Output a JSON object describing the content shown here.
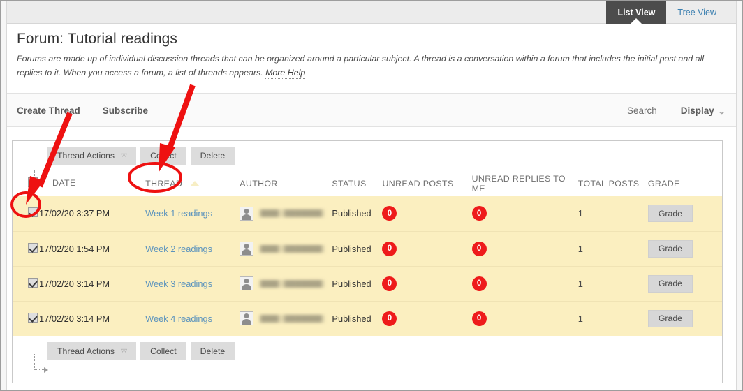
{
  "view_tabs": {
    "active": "List View",
    "inactive": "Tree View"
  },
  "header": {
    "title": "Forum: Tutorial readings",
    "description": "Forums are made up of individual discussion threads that can be organized around a particular subject. A thread is a conversation within a forum that includes the initial post and all replies to it. When you access a forum, a list of threads appears.",
    "more_help": "More Help"
  },
  "action_bar": {
    "create_thread": "Create Thread",
    "subscribe": "Subscribe",
    "search": "Search",
    "display": "Display",
    "display_caret": "⌄"
  },
  "bulk_toolbar": {
    "thread_actions": "Thread Actions",
    "thread_actions_caret": "»",
    "collect": "Collect",
    "delete": "Delete"
  },
  "table": {
    "columns": [
      {
        "key": "check",
        "label": ""
      },
      {
        "key": "date",
        "label": "DATE"
      },
      {
        "key": "thread",
        "label": "THREAD"
      },
      {
        "key": "author",
        "label": "AUTHOR"
      },
      {
        "key": "status",
        "label": "STATUS"
      },
      {
        "key": "unread",
        "label": "UNREAD POSTS"
      },
      {
        "key": "replies",
        "label": "UNREAD REPLIES TO ME"
      },
      {
        "key": "total",
        "label": "TOTAL POSTS"
      },
      {
        "key": "grade",
        "label": "GRADE"
      }
    ],
    "sorted_column": "THREAD",
    "sort_direction": "ascending",
    "filter_column": "DATE",
    "select_all_checked": true,
    "grade_button_label": "Grade",
    "rows": [
      {
        "checked": true,
        "date": "17/02/20 3:37 PM",
        "thread": "Week 1 readings",
        "author": "",
        "status": "Published",
        "unread_posts": "0",
        "unread_replies": "0",
        "total_posts": "1",
        "grade": "Grade"
      },
      {
        "checked": true,
        "date": "17/02/20 1:54 PM",
        "thread": "Week 2 readings",
        "author": "",
        "status": "Published",
        "unread_posts": "0",
        "unread_replies": "0",
        "total_posts": "1",
        "grade": "Grade"
      },
      {
        "checked": true,
        "date": "17/02/20 3:14 PM",
        "thread": "Week 3 readings",
        "author": "",
        "status": "Published",
        "unread_posts": "0",
        "unread_replies": "0",
        "total_posts": "1",
        "grade": "Grade"
      },
      {
        "checked": true,
        "date": "17/02/20 3:14 PM",
        "thread": "Week 4 readings",
        "author": "",
        "status": "Published",
        "unread_posts": "0",
        "unread_replies": "0",
        "total_posts": "1",
        "grade": "Grade"
      }
    ]
  },
  "annotations": {
    "color": "#ee1111",
    "arrow_to_select_all": "arrow pointing to select-all checkbox",
    "arrow_to_collect": "arrow pointing to Collect button",
    "circle_select_all": "red ellipse around select-all checkbox",
    "circle_collect": "red ellipse around Collect button"
  },
  "colors": {
    "row_highlight": "#fbefc0",
    "badge": "#ee1b1b",
    "active_tab": "#4c4c4c",
    "link": "#5b93bd",
    "annotation_red": "#ee1111"
  }
}
